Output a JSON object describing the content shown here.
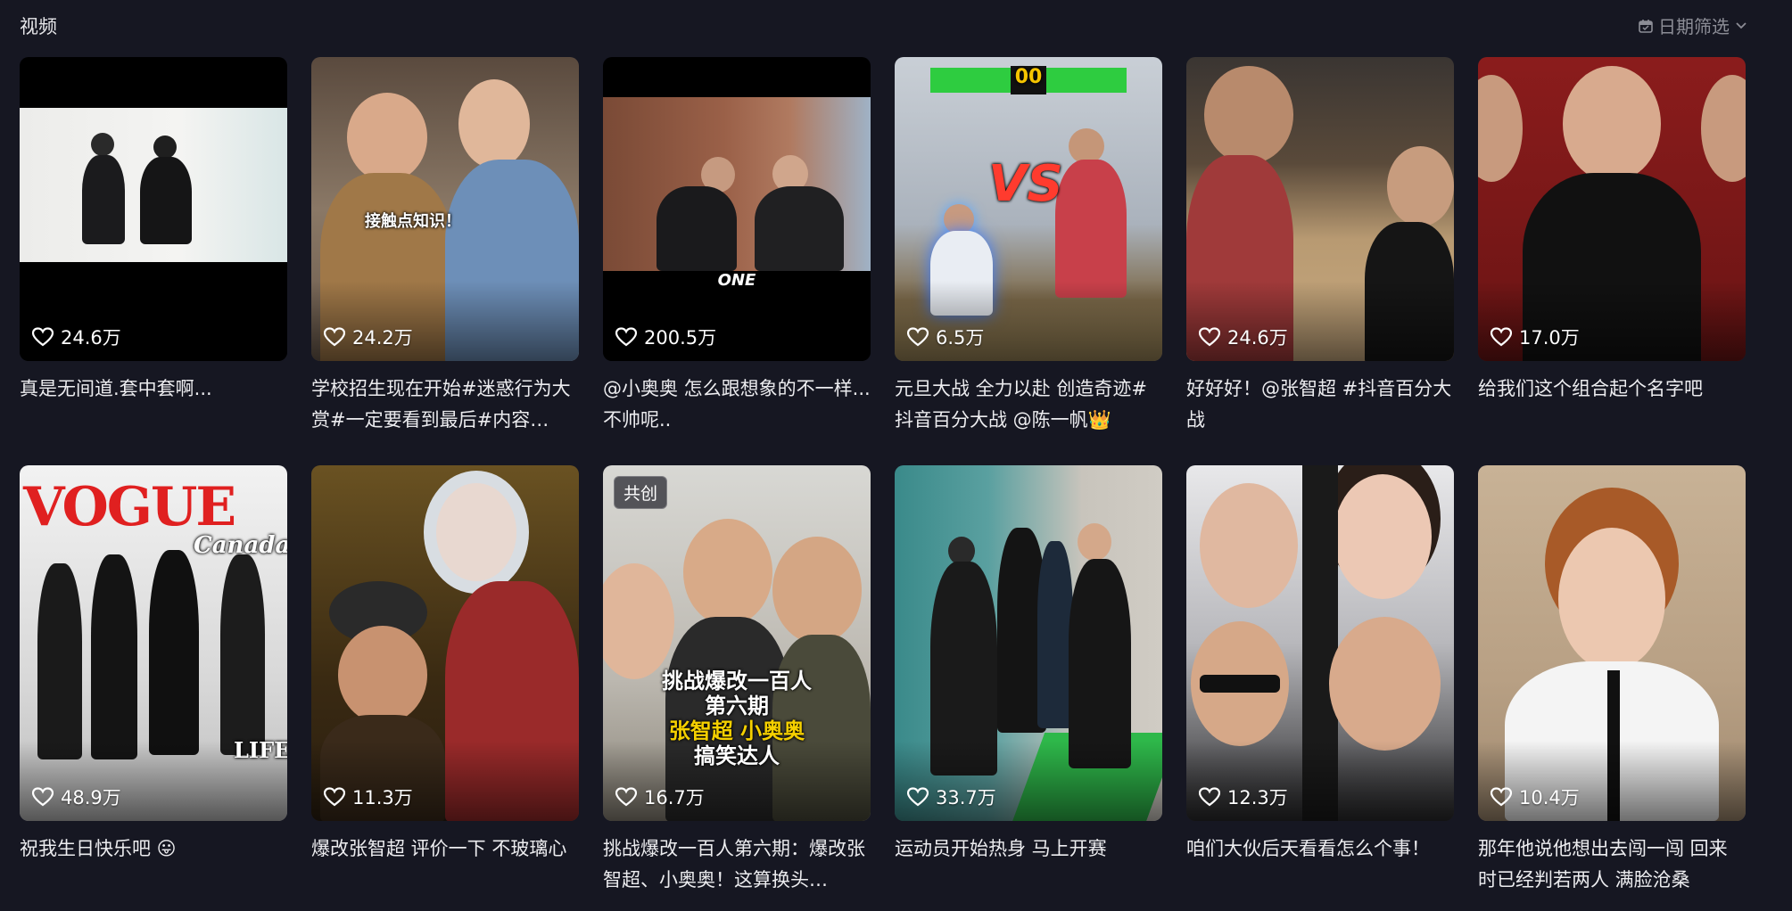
{
  "header": {
    "title": "视频",
    "date_filter_label": "日期筛选"
  },
  "videos": [
    {
      "likes": "24.6万",
      "caption": "真是无间道.套中套啊..."
    },
    {
      "likes": "24.2万",
      "caption": "学校招生现在开始#迷惑行为大赏#一定要看到最后#内容…",
      "thumb_text": "接触点知识！"
    },
    {
      "likes": "200.5万",
      "caption": "@小奥奥 怎么跟想象的不一样...不帅呢..",
      "thumb_text": "ONE"
    },
    {
      "likes": "6.5万",
      "caption": "元旦大战 全力以赴 创造奇迹#抖音百分大战 @陈一帆👑",
      "thumb_text": "00",
      "thumb_text2": "VS"
    },
    {
      "likes": "24.6万",
      "caption": "好好好！@张智超 #抖音百分大战"
    },
    {
      "likes": "17.0万",
      "caption": "给我们这个组合起个名字吧"
    },
    {
      "likes": "48.9万",
      "caption": "祝我生日快乐吧 😛",
      "thumb_text": "VOGUE",
      "thumb_text2": "Canada",
      "thumb_text3": "LIFE"
    },
    {
      "likes": "11.3万",
      "caption": "爆改张智超 评价一下 不玻璃心"
    },
    {
      "likes": "16.7万",
      "caption": "挑战爆改一百人第六期：爆改张智超、小奥奥！这算换头…",
      "badge": "共创",
      "thumb_text": "挑战爆改一百人",
      "thumb_text2": "第六期",
      "thumb_text3": "张智超 小奥奥",
      "thumb_text4": "搞笑达人"
    },
    {
      "likes": "33.7万",
      "caption": "运动员开始热身 马上开赛"
    },
    {
      "likes": "12.3万",
      "caption": "咱们大伙后天看看怎么个事！"
    },
    {
      "likes": "10.4万",
      "caption": "那年他说他想出去闯一闯 回来时已经判若两人 满脸沧桑"
    }
  ],
  "icons": {
    "heart": "heart-icon",
    "calendar": "calendar-icon",
    "chevron": "chevron-down-icon"
  }
}
